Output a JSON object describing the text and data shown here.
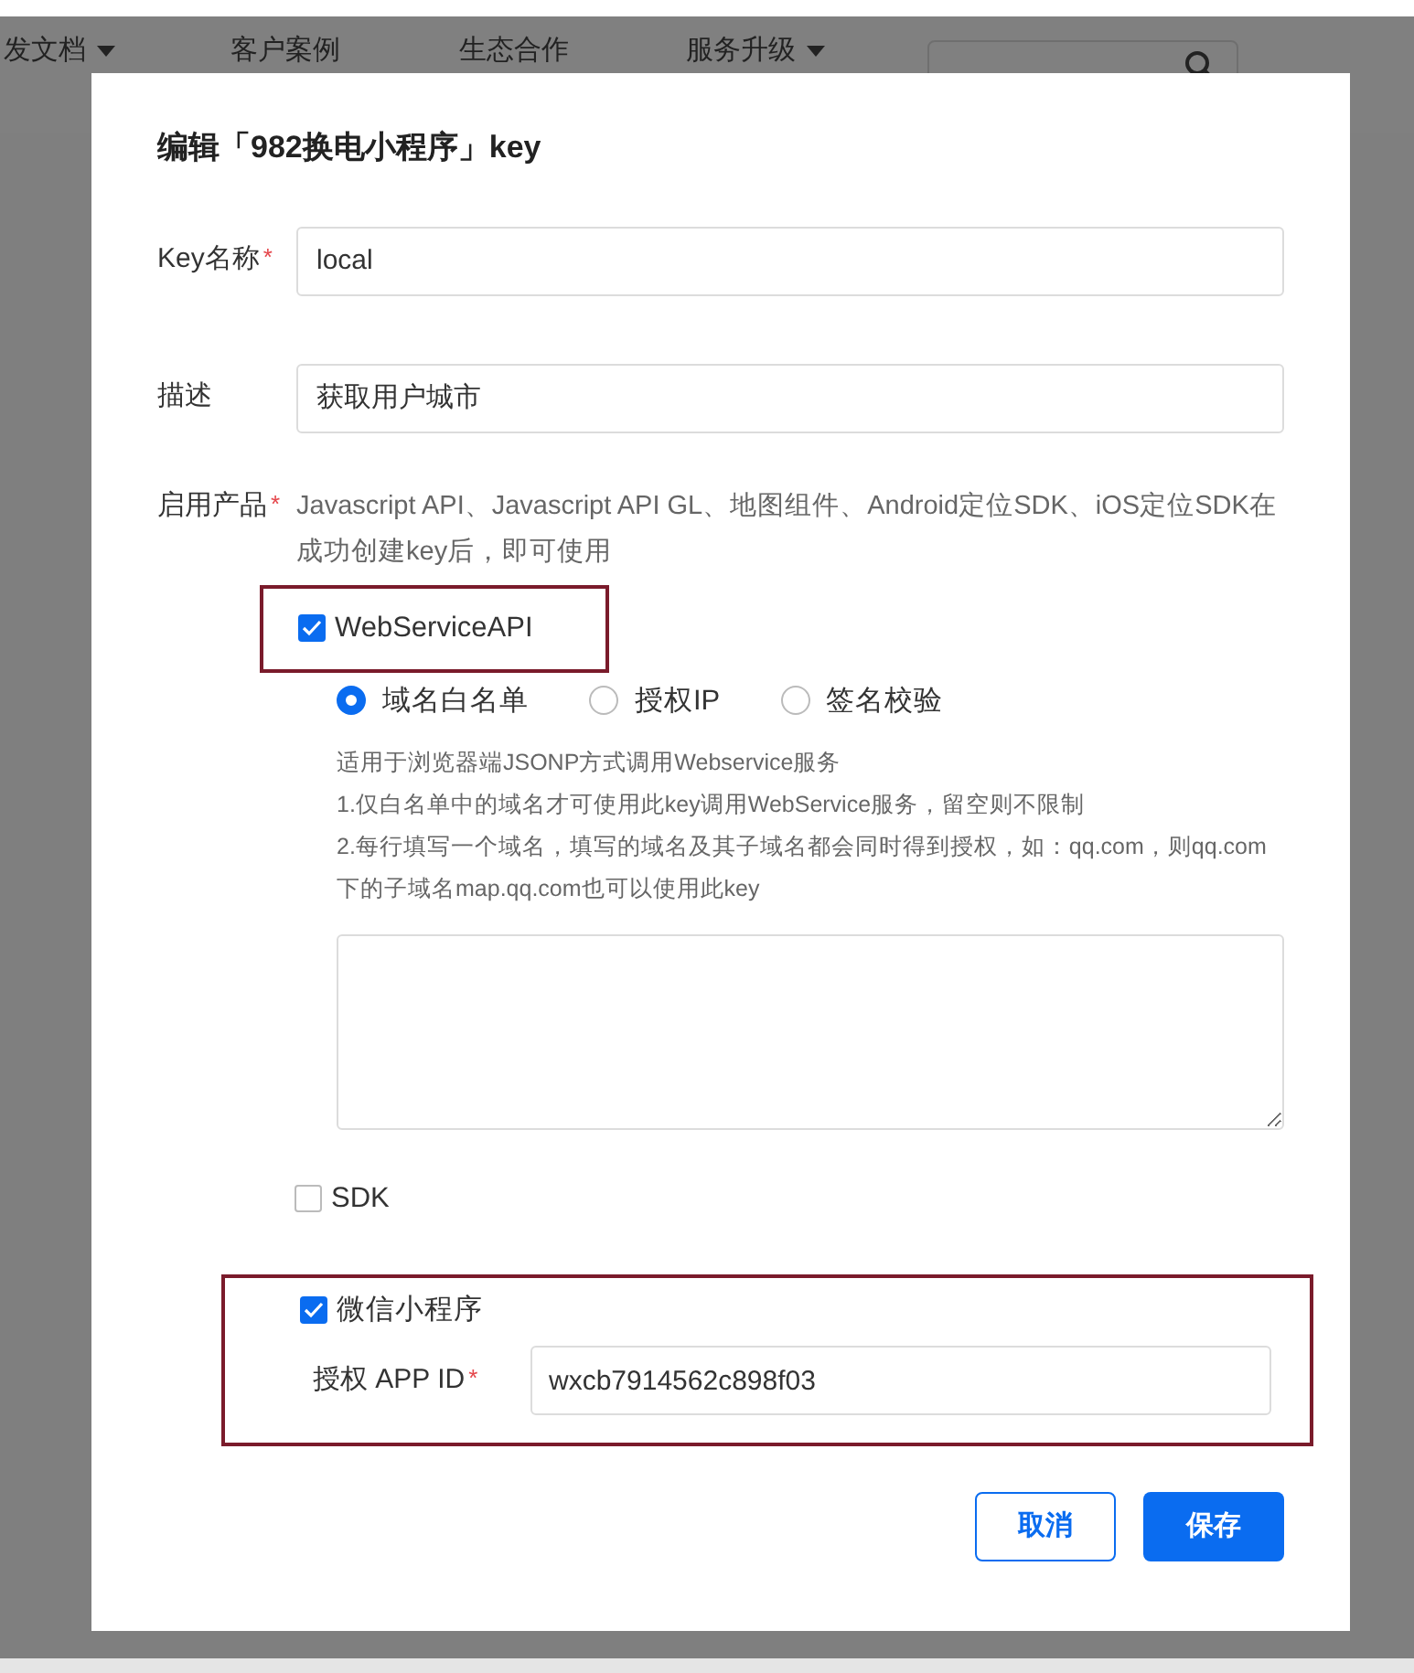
{
  "nav": {
    "items": [
      {
        "label": "发文档",
        "has_caret": true
      },
      {
        "label": "客户案例",
        "has_caret": false
      },
      {
        "label": "生态合作",
        "has_caret": false
      },
      {
        "label": "服务升级",
        "has_caret": true
      }
    ]
  },
  "dialog": {
    "title": "编辑「982换电小程序」key",
    "fields": [
      {
        "label": "Key名称",
        "required_mark": "*",
        "value": "local"
      },
      {
        "label": "描述",
        "value": "获取用户城市"
      }
    ],
    "products": {
      "label": "启用产品",
      "required_mark": "*",
      "note": "Javascript API、Javascript API GL、地图组件、Android定位SDK、iOS定位SDK在成功创建key后，即可使用",
      "options": [
        {
          "kind": "webservice",
          "label": "WebServiceAPI",
          "checked": true,
          "highlighted": true,
          "modes": [
            {
              "label": "域名白名单",
              "selected": true
            },
            {
              "label": "授权IP",
              "selected": false
            },
            {
              "label": "签名校验",
              "selected": false
            }
          ],
          "help": [
            "适用于浏览器端JSONP方式调用Webservice服务",
            "1.仅白名单中的域名才可使用此key调用WebService服务，留空则不限制",
            "2.每行填写一个域名，填写的域名及其子域名都会同时得到授权，如：qq.com，则qq.com下的子域名map.qq.com也可以使用此key"
          ]
        },
        {
          "kind": "plain",
          "label": "SDK",
          "checked": false
        },
        {
          "kind": "miniprogram",
          "label": "微信小程序",
          "checked": true,
          "highlighted": true,
          "appid_label": "授权 APP ID",
          "appid_required_mark": "*",
          "appid_value": "wxcb7914562c898f03"
        }
      ]
    },
    "buttons": [
      {
        "label": "取消",
        "primary": false
      },
      {
        "label": "保存",
        "primary": true
      }
    ]
  }
}
